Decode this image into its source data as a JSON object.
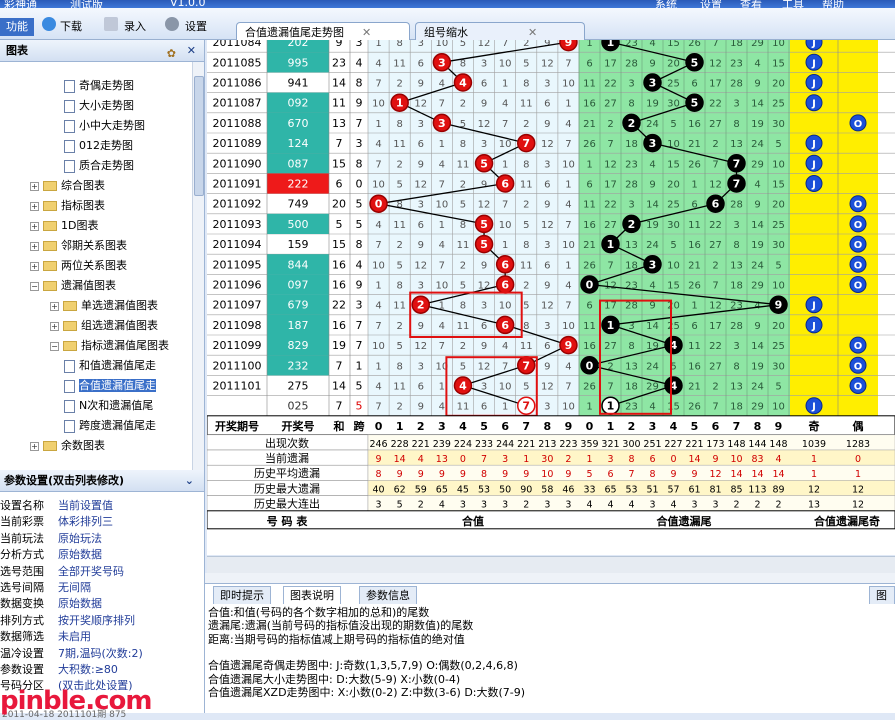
{
  "app": {
    "title_fragments": [
      "彩神通",
      "测试版",
      "V1.0.0"
    ],
    "menu": [
      "系统",
      "设置",
      "查看",
      "工具",
      "帮助"
    ]
  },
  "toolbar": {
    "items": [
      "功能",
      "下载",
      "录入",
      "设置"
    ],
    "tabs": [
      "合值遗漏值尾走势图",
      "组号缩水"
    ]
  },
  "left_panel": {
    "title": "图表",
    "tree": [
      {
        "label": "奇偶走势图",
        "level": 3,
        "kind": "doc"
      },
      {
        "label": "大小走势图",
        "level": 3,
        "kind": "doc"
      },
      {
        "label": "小中大走势图",
        "level": 3,
        "kind": "doc"
      },
      {
        "label": "012走势图",
        "level": 3,
        "kind": "doc"
      },
      {
        "label": "质合走势图",
        "level": 3,
        "kind": "doc"
      },
      {
        "label": "综合图表",
        "level": 1,
        "kind": "folder",
        "exp": "+"
      },
      {
        "label": "指标图表",
        "level": 1,
        "kind": "folder",
        "exp": "+"
      },
      {
        "label": "1D图表",
        "level": 1,
        "kind": "folder",
        "exp": "+"
      },
      {
        "label": "邻期关系图表",
        "level": 1,
        "kind": "folder",
        "exp": "+"
      },
      {
        "label": "两位关系图表",
        "level": 1,
        "kind": "folder",
        "exp": "+"
      },
      {
        "label": "遗漏值图表",
        "level": 1,
        "kind": "folder",
        "exp": "−"
      },
      {
        "label": "单选遗漏值图表",
        "level": 2,
        "kind": "folder",
        "exp": "+"
      },
      {
        "label": "组选遗漏值图表",
        "level": 2,
        "kind": "folder",
        "exp": "+"
      },
      {
        "label": "指标遗漏值尾图表",
        "level": 2,
        "kind": "folder",
        "exp": "−"
      },
      {
        "label": "和值遗漏值尾走",
        "level": 3,
        "kind": "doc"
      },
      {
        "label": "合值遗漏值尾走",
        "level": 3,
        "kind": "doc",
        "selected": true
      },
      {
        "label": "N次和遗漏值尾",
        "level": 3,
        "kind": "doc"
      },
      {
        "label": "跨度遗漏值尾走",
        "level": 3,
        "kind": "doc"
      },
      {
        "label": "余数图表",
        "level": 1,
        "kind": "folder",
        "exp": "+"
      }
    ]
  },
  "param_panel": {
    "title": "参数设置(双击列表修改)",
    "rows": [
      {
        "k": "设置名称",
        "v": "当前设置值"
      },
      {
        "k": "当前彩票",
        "v": "体彩排列三"
      },
      {
        "k": "当前玩法",
        "v": "原始玩法"
      },
      {
        "k": "分析方式",
        "v": "原始数据"
      },
      {
        "k": "选号范围",
        "v": "全部开奖号码"
      },
      {
        "k": "选号间隔",
        "v": "无间隔"
      },
      {
        "k": "数据变换",
        "v": "原始数据"
      },
      {
        "k": "排列方式",
        "v": "按开奖顺序排列"
      },
      {
        "k": "数据筛选",
        "v": "未启用"
      },
      {
        "k": "温冷设置",
        "v": "7期,温码(次数:2)"
      },
      {
        "k": "参数设置",
        "v": "大积数:≥80"
      },
      {
        "k": "号码分区",
        "v": "(双击此处设置)"
      }
    ],
    "watermark": "pinble.com",
    "status": "2011-04-18 2011101期 875"
  },
  "chart_data": {
    "type": "table",
    "headers": {
      "issue": "开奖期号",
      "number": "开奖号",
      "sum": "和",
      "span": "跨",
      "digits": [
        "0",
        "1",
        "2",
        "3",
        "4",
        "5",
        "6",
        "7",
        "8",
        "9"
      ],
      "parity": [
        "奇",
        "偶"
      ]
    },
    "rows": [
      {
        "issue": "2011084",
        "num": "202",
        "sum": "9",
        "span": "3",
        "hv": 9,
        "miss": 1,
        "bg": "#2fb5a8",
        "part": true
      },
      {
        "issue": "2011085",
        "num": "995",
        "sum": "23",
        "span": "4",
        "hv": 3,
        "miss": 5,
        "bg": "#2fb5a8"
      },
      {
        "issue": "2011086",
        "num": "941",
        "sum": "14",
        "span": "8",
        "hv": 4,
        "miss": 3,
        "bg": ""
      },
      {
        "issue": "2011087",
        "num": "092",
        "sum": "11",
        "span": "9",
        "hv": 1,
        "miss": 5,
        "bg": "#2fb5a8"
      },
      {
        "issue": "2011088",
        "num": "670",
        "sum": "13",
        "span": "7",
        "hv": 3,
        "miss": 2,
        "bg": "#2fb5a8"
      },
      {
        "issue": "2011089",
        "num": "124",
        "sum": "7",
        "span": "3",
        "hv": 7,
        "miss": 3,
        "bg": "#2fb5a8"
      },
      {
        "issue": "2011090",
        "num": "087",
        "sum": "15",
        "span": "8",
        "hv": 5,
        "miss": 7,
        "bg": "#2fb5a8"
      },
      {
        "issue": "2011091",
        "num": "222",
        "sum": "6",
        "span": "0",
        "hv": 6,
        "miss": 7,
        "bg": "#ee1a1a"
      },
      {
        "issue": "2011092",
        "num": "749",
        "sum": "20",
        "span": "5",
        "hv": 0,
        "miss": 6,
        "bg": ""
      },
      {
        "issue": "2011093",
        "num": "500",
        "sum": "5",
        "span": "5",
        "hv": 5,
        "miss": 2,
        "bg": "#2fb5a8"
      },
      {
        "issue": "2011094",
        "num": "159",
        "sum": "15",
        "span": "8",
        "hv": 5,
        "miss": 1,
        "bg": ""
      },
      {
        "issue": "2011095",
        "num": "844",
        "sum": "16",
        "span": "4",
        "hv": 6,
        "miss": 3,
        "bg": "#2fb5a8"
      },
      {
        "issue": "2011096",
        "num": "097",
        "sum": "16",
        "span": "9",
        "hv": 6,
        "miss": 0,
        "bg": "#2fb5a8"
      },
      {
        "issue": "2011097",
        "num": "679",
        "sum": "22",
        "span": "3",
        "hv": 2,
        "miss": 9,
        "bg": "#2fb5a8"
      },
      {
        "issue": "2011098",
        "num": "187",
        "sum": "16",
        "span": "7",
        "hv": 6,
        "miss": 1,
        "bg": "#2fb5a8"
      },
      {
        "issue": "2011099",
        "num": "829",
        "sum": "19",
        "span": "7",
        "hv": 9,
        "miss": 4,
        "bg": "#2fb5a8"
      },
      {
        "issue": "2011100",
        "num": "232",
        "sum": "7",
        "span": "1",
        "hv": 7,
        "miss": 0,
        "bg": "#2fb5a8"
      },
      {
        "issue": "2011101",
        "num": "275",
        "sum": "14",
        "span": "5",
        "hv": 4,
        "miss": 4,
        "bg": ""
      },
      {
        "issue": "",
        "num": "025",
        "sum": "7",
        "span": "5",
        "hv": 7,
        "miss": 1,
        "bg": "",
        "predict": true
      }
    ],
    "parity_marks": [
      "J",
      "J",
      "J",
      "J",
      "O",
      "J",
      "J",
      "J",
      "O",
      "O",
      "O",
      "O",
      "O",
      "J",
      "J",
      "O",
      "O",
      "O",
      "J"
    ],
    "stats": [
      {
        "label": "出现次数",
        "vals": [
          "246",
          "228",
          "221",
          "239",
          "224",
          "233",
          "244",
          "221",
          "213",
          "223",
          "359",
          "321",
          "300",
          "251",
          "227",
          "221",
          "173",
          "148",
          "144",
          "148",
          "1039",
          "1283"
        ]
      },
      {
        "label": "当前遗漏",
        "vals": [
          "9",
          "14",
          "4",
          "13",
          "0",
          "7",
          "3",
          "1",
          "30",
          "2",
          "1",
          "3",
          "8",
          "6",
          "0",
          "14",
          "9",
          "10",
          "83",
          "4",
          "1",
          "0"
        ]
      },
      {
        "label": "历史平均遗漏",
        "vals": [
          "8",
          "9",
          "9",
          "9",
          "9",
          "8",
          "9",
          "9",
          "10",
          "9",
          "5",
          "6",
          "7",
          "8",
          "9",
          "9",
          "12",
          "14",
          "14",
          "14",
          "1",
          "1"
        ]
      },
      {
        "label": "历史最大遗漏",
        "vals": [
          "40",
          "62",
          "59",
          "65",
          "45",
          "53",
          "50",
          "90",
          "58",
          "46",
          "33",
          "65",
          "53",
          "51",
          "57",
          "61",
          "81",
          "85",
          "113",
          "89",
          "12",
          "12"
        ]
      },
      {
        "label": "历史最大连出",
        "vals": [
          "3",
          "5",
          "2",
          "4",
          "3",
          "3",
          "3",
          "2",
          "3",
          "3",
          "4",
          "4",
          "4",
          "3",
          "4",
          "3",
          "3",
          "2",
          "2",
          "2",
          "13",
          "12"
        ]
      }
    ],
    "footer_labels": [
      "号  码  表",
      "合值",
      "合值遗漏尾",
      "合值遗漏尾奇"
    ]
  },
  "bottom": {
    "tabs": [
      "即时提示",
      "图表说明",
      "参数信息"
    ],
    "right_tab": "图表",
    "lines": [
      "合值:和值(号码的各个数字相加的总和)的尾数",
      "遗漏尾:遗漏(当前号码的指标值没出现的期数值)的尾数",
      "距离:当期号码的指标值减上期号码的指标值的绝对值",
      "",
      "合值遗漏尾奇偶走势图中:  J:奇数(1,3,5,7,9)  O:偶数(0,2,4,6,8)",
      "合值遗漏尾大小走势图中:  D:大数(5-9)  X:小数(0-4)",
      "合值遗漏尾XZD走势图中:  X:小数(0-2)  Z:中数(3-6)  D:大数(7-9)"
    ]
  }
}
